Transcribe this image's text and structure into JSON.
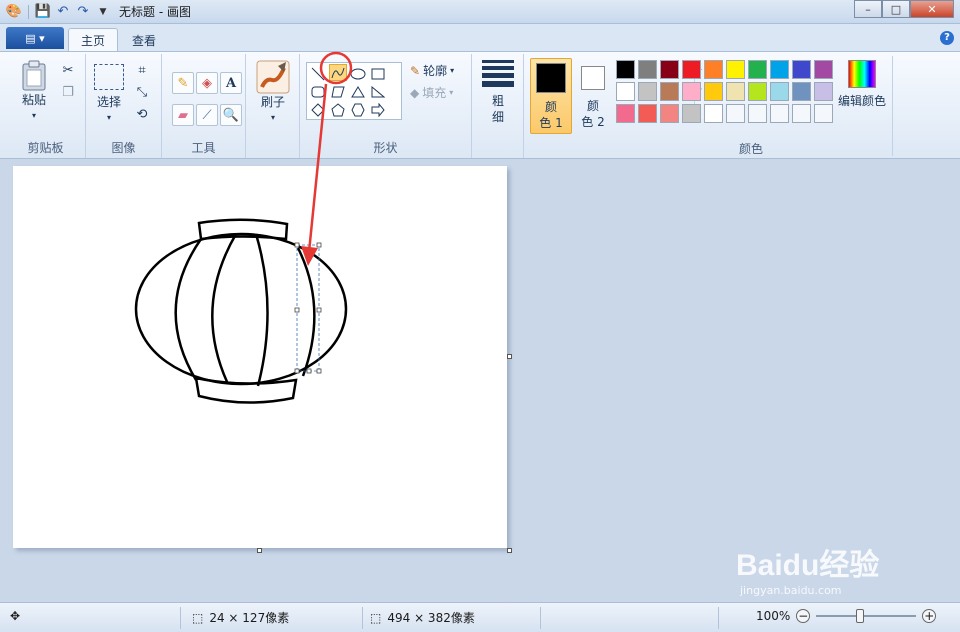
{
  "window": {
    "title": "无标题 - 画图"
  },
  "tabs": [
    {
      "label": "主页"
    },
    {
      "label": "查看"
    }
  ],
  "ribbon": {
    "clipboard": {
      "paste_label": "粘贴",
      "group_label": "剪贴板"
    },
    "image": {
      "select_label": "选择",
      "group_label": "图像"
    },
    "tools": {
      "group_label": "工具",
      "text_tool": "A"
    },
    "brushes": {
      "label": "刷子"
    },
    "shapes": {
      "group_label": "形状",
      "outline_label": "轮廓",
      "fill_label": "填充"
    },
    "size": {
      "label_line1": "粗",
      "label_line2": "细"
    },
    "colors": {
      "color1_line1": "颜",
      "color1_line2": "色 1",
      "color2_line1": "颜",
      "color2_line2": "色 2",
      "edit_label": "编辑颜色",
      "group_label": "颜色",
      "color1_value": "#000000",
      "color2_value": "#ffffff",
      "palette": [
        [
          "#000000",
          "#7f7f7f",
          "#880015",
          "#ed1c24",
          "#ff7f27",
          "#fff200",
          "#22b14c",
          "#00a2e8",
          "#3f48cc",
          "#a349a4"
        ],
        [
          "#ffffff",
          "#c3c3c3",
          "#b97a57",
          "#ffaec9",
          "#ffc90e",
          "#efe4b0",
          "#b5e61d",
          "#99d9ea",
          "#7092be",
          "#c8bfe7"
        ],
        [
          "#f26a8d",
          "#f25c54",
          "#f28482",
          "#c3c3c3",
          "#ffffff",
          "",
          "",
          "",
          "",
          ""
        ]
      ]
    }
  },
  "status": {
    "selection_size": "24 × 127像素",
    "canvas_size": "494 × 382像素",
    "zoom": "100%"
  },
  "watermark": {
    "brand": "Baidu经验",
    "url": "jingyan.baidu.com"
  }
}
